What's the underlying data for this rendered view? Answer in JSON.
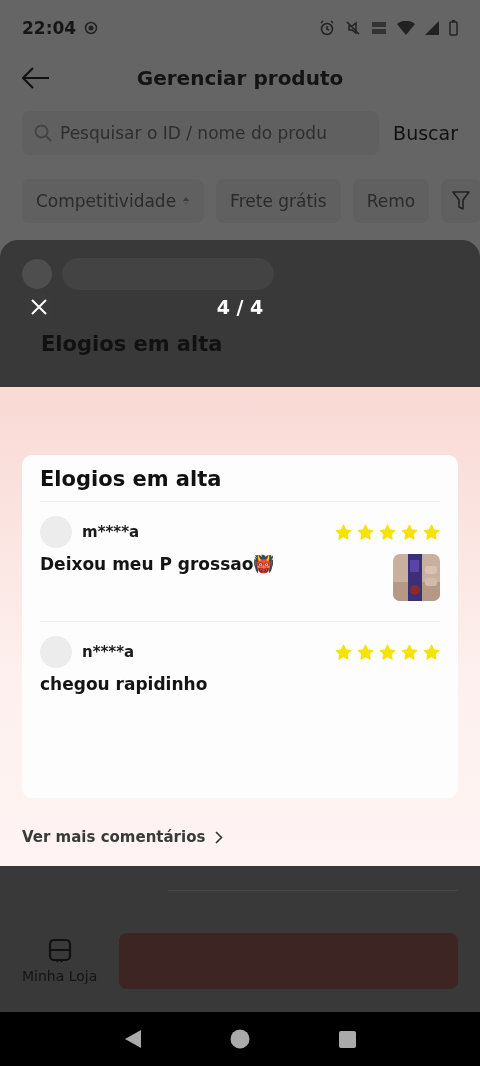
{
  "status_bar": {
    "time": "22:04"
  },
  "header": {
    "title": "Gerenciar produto"
  },
  "search": {
    "placeholder": "Pesquisar o ID / nome do produ",
    "button": "Buscar"
  },
  "filters": [
    {
      "label": "Competitividade",
      "kind": "sort"
    },
    {
      "label": "Frete grátis",
      "kind": "plain"
    },
    {
      "label": "Remo",
      "kind": "plain"
    }
  ],
  "viewer": {
    "counter": "4 / 4",
    "behind_title": "Elogios em alta"
  },
  "panel": {
    "title": "Elogios em alta",
    "reviews": [
      {
        "user": "m****a",
        "stars": 5,
        "text": "Deixou meu P grossao👹"
      },
      {
        "user": "n****a",
        "stars": 5,
        "text": "chegou rapidinho"
      }
    ],
    "more_link": "Ver mais comentários"
  },
  "bottom_bar": {
    "store_label": "Minha Loja"
  }
}
